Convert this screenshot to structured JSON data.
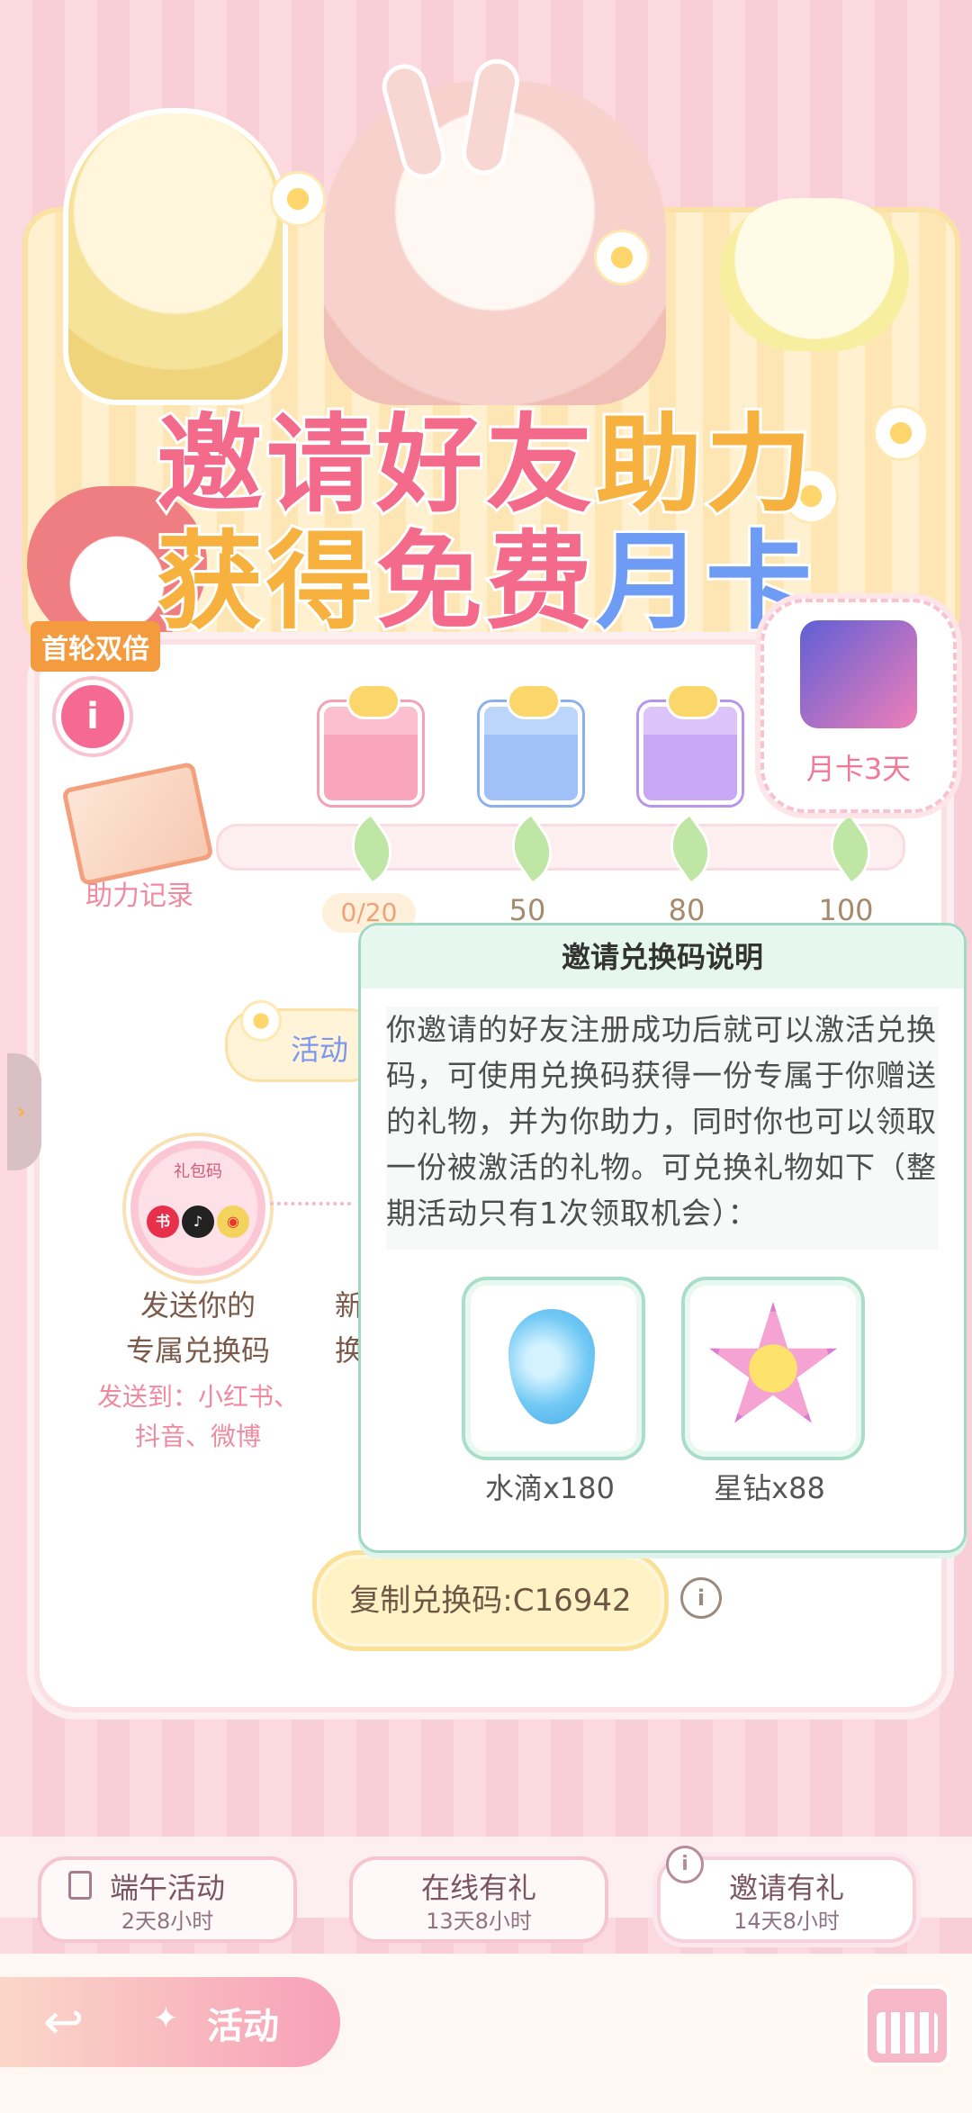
{
  "banner": {
    "title_line1": [
      "邀请",
      "好友",
      "助力"
    ],
    "title_line2": [
      "获得",
      "免费",
      "月卡"
    ],
    "badge": "首轮双倍"
  },
  "progress": {
    "record_label": "助力记录",
    "count": "0/20",
    "milestones": [
      "50",
      "80",
      "100"
    ],
    "final_reward": "月卡3天"
  },
  "activity_pill": "活动",
  "steps": {
    "step1_title_line1": "发送你的",
    "step1_title_line2": "专属兑换码",
    "step1_sub_line1": "发送到：小红书、",
    "step1_sub_line2": "抖音、微博",
    "step1_icon_text": "礼包码",
    "step2_title_line1": "新",
    "step2_title_line2": "换"
  },
  "copy_button": "复制兑换码:C16942",
  "popup": {
    "title": "邀请兑换码说明",
    "body_lines": [
      "你邀请的好友注册成功后就可以激活兑换",
      "码，可使用兑换码获得一份专属于你赠送",
      "的礼物，并为你助力，同时你也可以领取",
      "一份被激活的礼物。可兑换礼物如下（整",
      "期活动只有1次领取机会）："
    ],
    "gifts": [
      {
        "label": "水滴x180",
        "icon": "water-drop-icon"
      },
      {
        "label": "星钻x88",
        "icon": "star-diamond-icon"
      }
    ]
  },
  "tabs": [
    {
      "name": "端午活动",
      "time": "2天8小时"
    },
    {
      "name": "在线有礼",
      "time": "13天8小时"
    },
    {
      "name": "邀请有礼",
      "time": "14天8小时"
    }
  ],
  "bottom": {
    "activity_label": "活动"
  },
  "colors": {
    "accent_pink": "#f56a92",
    "popup_border": "#9ed9c4",
    "badge_orange": "#f39b3e"
  }
}
